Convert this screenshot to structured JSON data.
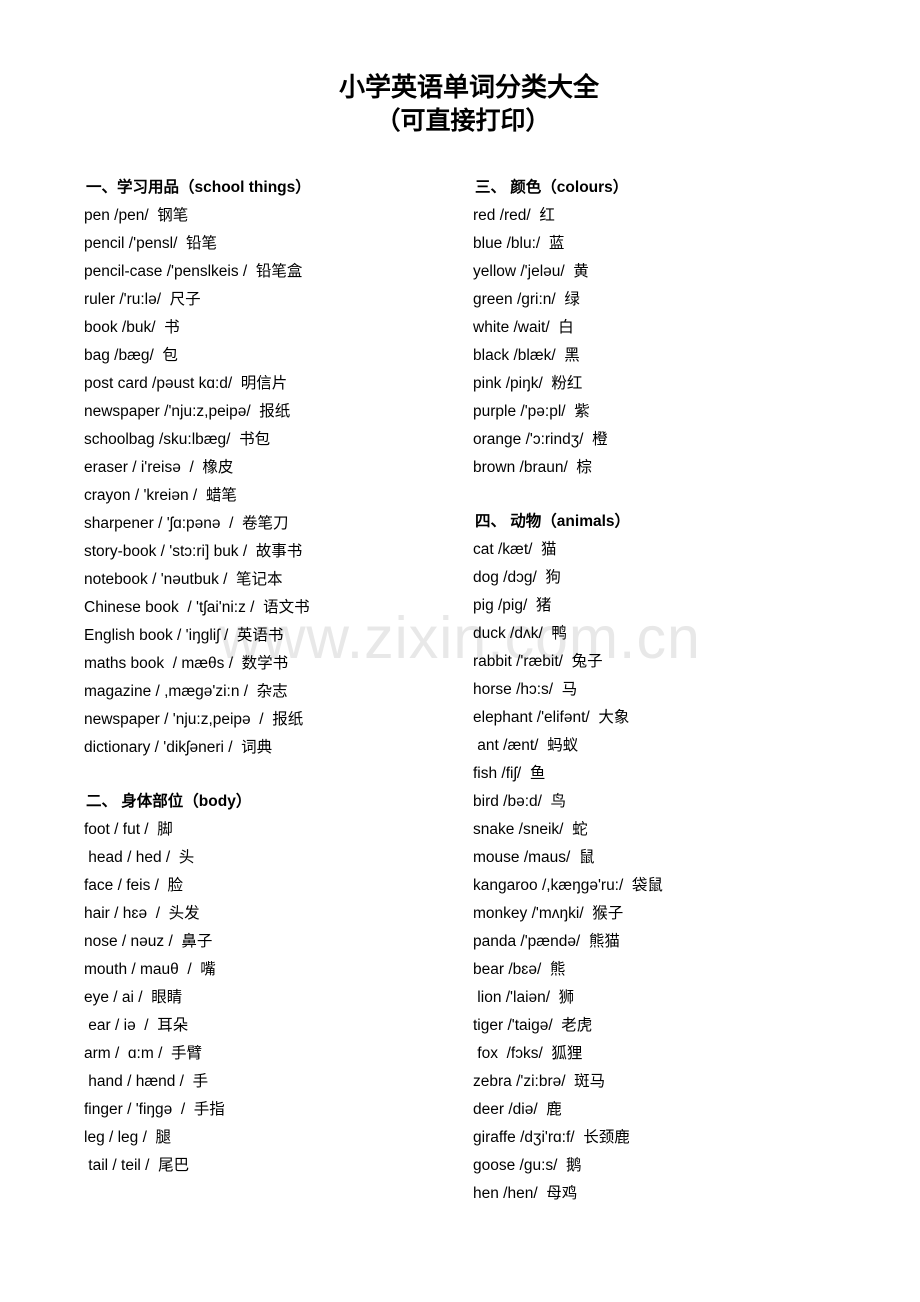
{
  "document": {
    "title_main": "小学英语单词分类大全",
    "title_sub": "（可直接打印）",
    "watermark": "www.zixin.com.cn"
  },
  "columns": {
    "left": [
      {
        "heading": "一、学习用品（school things）",
        "items": [
          "pen /pen/  钢笔",
          "pencil /'pensl/  铅笔",
          "pencil-case /'penslkeis /  铅笔盒",
          "ruler /'ru:lə/  尺子",
          "book /buk/  书",
          "bag /bæg/  包",
          "post card /pəust kɑ:d/  明信片",
          "newspaper /'nju:z,peipə/  报纸",
          "schoolbag /sku:lbæg/  书包",
          "eraser / i'reisə  /  橡皮",
          "crayon / 'kreiən /  蜡笔",
          "sharpener / 'ʃɑ:pənə  /  卷笔刀",
          "story-book / 'stɔ:ri] buk /  故事书",
          "notebook / 'nəutbuk /  笔记本",
          "Chinese book  / 'tʃai'ni:z /  语文书",
          "English book / 'iŋgliʃ /  英语书",
          "maths book  / mæθs /  数学书",
          "magazine / ,mægə'zi:n /  杂志",
          "newspaper / 'nju:z,peipə  /  报纸",
          "dictionary / 'dikʃəneri /  词典"
        ]
      },
      {
        "heading": "二、 身体部位（body）",
        "items": [
          "foot / fut /  脚",
          " head / hed /  头",
          "face / feis /  脸",
          "hair / hɛə  /  头发",
          "nose / nəuz /  鼻子",
          "mouth / mauθ  /  嘴",
          "eye / ai /  眼睛",
          " ear / iə  /  耳朵",
          "arm /  ɑ:m /  手臂",
          " hand / hænd /  手",
          "finger / 'fiŋgə  /  手指",
          "leg / leg /  腿",
          " tail / teil /  尾巴"
        ]
      }
    ],
    "right": [
      {
        "heading": "三、 颜色（colours）",
        "items": [
          "red /red/  红",
          "blue /blu:/  蓝",
          "yellow /'jeləu/  黄",
          "green /gri:n/  绿",
          "white /wait/  白",
          "black /blæk/  黑",
          "pink /piŋk/  粉红",
          "purple /'pə:pl/  紫",
          "orange /'ɔ:rindʒ/  橙",
          "brown /braun/  棕"
        ]
      },
      {
        "heading": "四、 动物（animals）",
        "items": [
          "cat /kæt/  猫",
          "dog /dɔg/  狗",
          "pig /pig/  猪",
          "duck /dʌk/  鸭",
          "rabbit /'ræbit/  兔子",
          "horse /hɔ:s/  马",
          "elephant /'elifənt/  大象",
          " ant /ænt/  蚂蚁",
          "fish /fiʃ/  鱼",
          "bird /bə:d/  鸟",
          "snake /sneik/  蛇",
          "mouse /maus/  鼠",
          "kangaroo /,kæŋgə'ru:/  袋鼠",
          "monkey /'mʌŋki/  猴子",
          "panda /'pændə/  熊猫",
          "bear /bɛə/  熊",
          " lion /'laiən/  狮",
          "tiger /'taigə/  老虎",
          " fox  /fɔks/  狐狸",
          "zebra /'zi:brə/  斑马",
          "deer /diə/  鹿",
          "giraffe /dʒi'rɑ:f/  长颈鹿",
          "goose /gu:s/  鹅",
          "hen /hen/  母鸡"
        ]
      }
    ]
  }
}
